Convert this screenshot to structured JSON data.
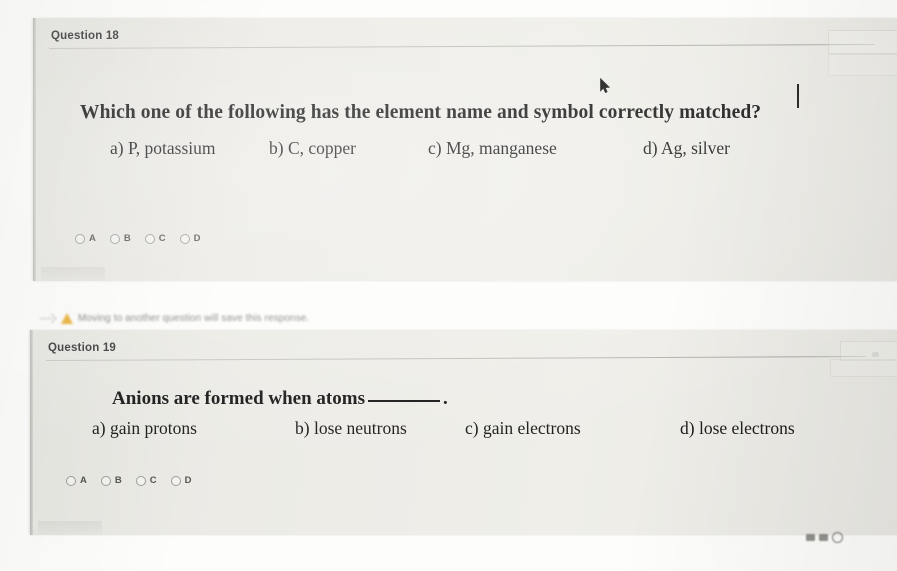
{
  "page": {
    "background_color": "#fdfdfb",
    "card_color": "#eceae5"
  },
  "questions": [
    {
      "label": "Question 18",
      "stem": "Which one of the following has the element name and symbol correctly matched?",
      "has_blank": false,
      "options": [
        {
          "text": "a) P, potassium"
        },
        {
          "text": "b) C, copper"
        },
        {
          "text": "c) Mg, manganese"
        },
        {
          "text": "d) Ag, silver"
        }
      ],
      "choices": [
        {
          "letter": "A",
          "selected": false
        },
        {
          "letter": "B",
          "selected": false
        },
        {
          "letter": "C",
          "selected": false
        },
        {
          "letter": "D",
          "selected": false
        }
      ]
    },
    {
      "label": "Question 19",
      "stem_before_blank": "Anions are formed when atoms",
      "stem_after_blank": ".",
      "has_blank": true,
      "options": [
        {
          "text": "a) gain protons"
        },
        {
          "text": "b) lose neutrons"
        },
        {
          "text": "c) gain electrons"
        },
        {
          "text": "d) lose electrons"
        }
      ],
      "choices": [
        {
          "letter": "A",
          "selected": false
        },
        {
          "letter": "B",
          "selected": false
        },
        {
          "letter": "C",
          "selected": false
        },
        {
          "letter": "D",
          "selected": false
        }
      ]
    }
  ],
  "notice": {
    "text": "Moving to another question will save this response.",
    "icon": "warning-triangle-icon",
    "icon_color": "#e8a317"
  },
  "cursor": {
    "type": "arrow-pointer",
    "color": "#111111"
  },
  "caret": {
    "visible": true
  }
}
